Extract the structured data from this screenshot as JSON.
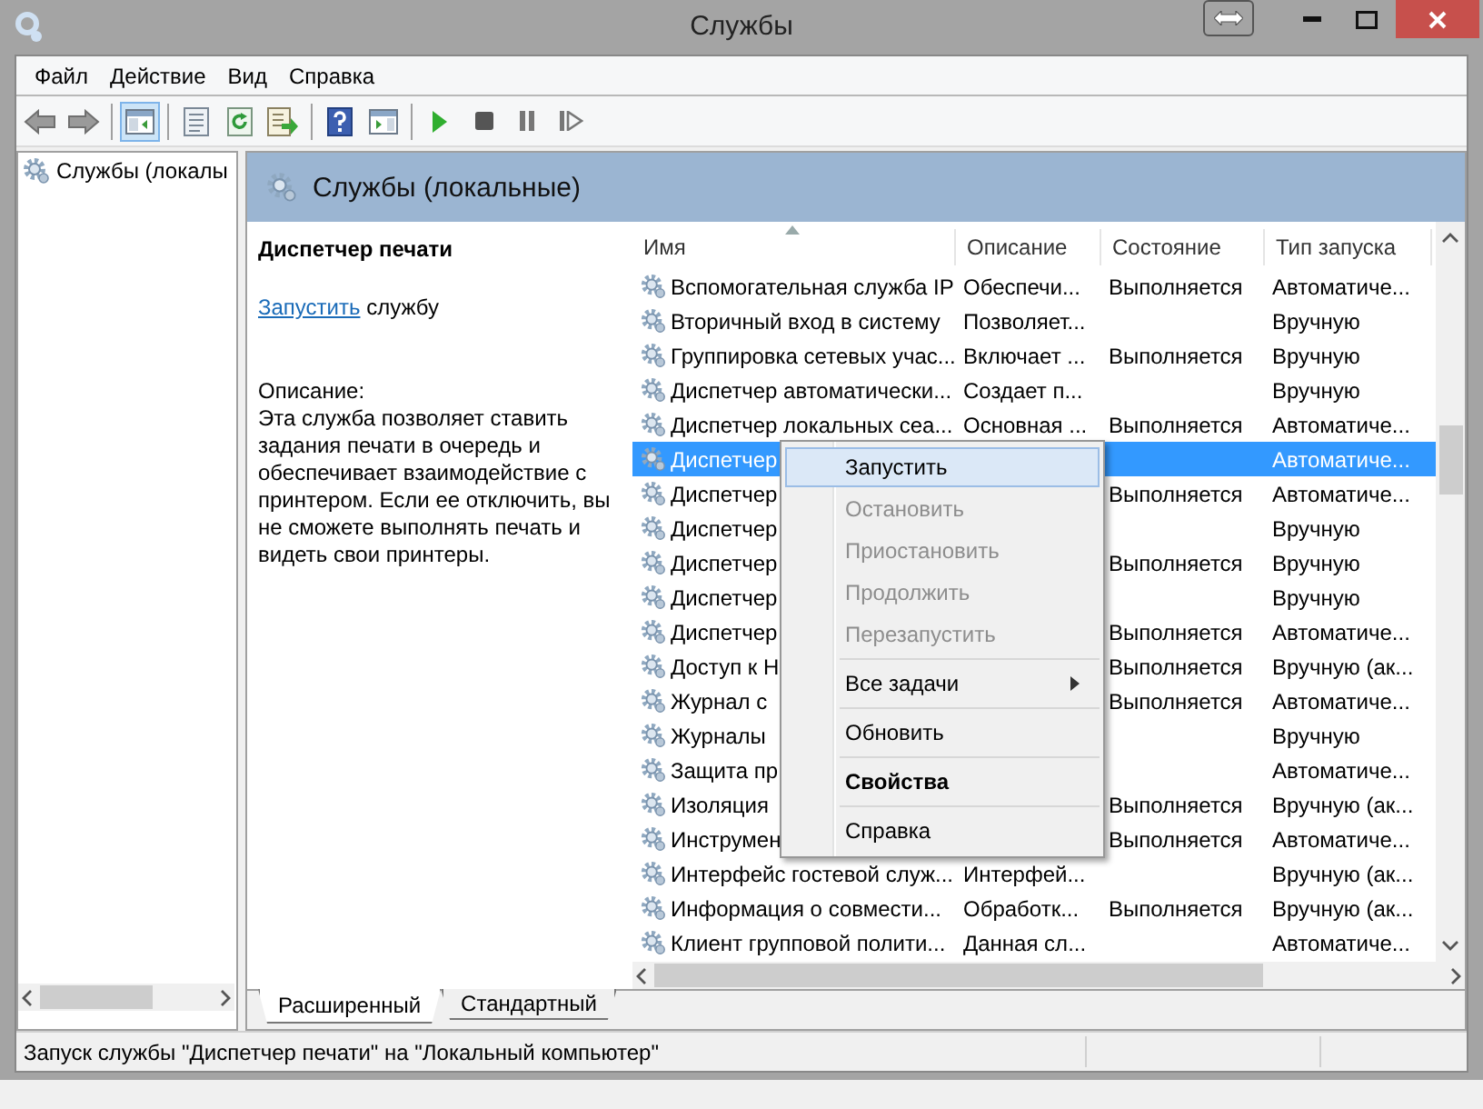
{
  "window": {
    "title": "Службы"
  },
  "menu": [
    "Файл",
    "Действие",
    "Вид",
    "Справка"
  ],
  "toolbar": [
    [
      {
        "kind": "back",
        "pressed": false
      },
      {
        "kind": "forward",
        "pressed": false
      }
    ],
    [
      {
        "kind": "tree",
        "pressed": true
      }
    ],
    [
      {
        "kind": "properties",
        "pressed": false
      },
      {
        "kind": "refresh",
        "pressed": false
      },
      {
        "kind": "export",
        "pressed": false
      }
    ],
    [
      {
        "kind": "help",
        "pressed": false
      },
      {
        "kind": "pane",
        "pressed": false
      }
    ],
    [
      {
        "kind": "play",
        "pressed": false
      },
      {
        "kind": "stop",
        "pressed": false
      },
      {
        "kind": "pause",
        "pressed": false
      },
      {
        "kind": "resume",
        "pressed": false
      }
    ]
  ],
  "tree": {
    "items": [
      {
        "label": "Службы (локалы",
        "selected": false
      }
    ]
  },
  "header": {
    "title": "Службы (локальные)"
  },
  "details": {
    "title": "Диспетчер печати",
    "action_link": "Запустить",
    "action_rest": " службу",
    "description_label": "Описание:",
    "description": "Эта служба позволяет ставить задания печати в очередь и обеспечивает взаимодействие с принтером. Если ее отключить, вы не сможете выполнять печать и видеть свои принтеры."
  },
  "table": {
    "columns": [
      "Имя",
      "Описание",
      "Состояние",
      "Тип запуска"
    ],
    "rows": [
      {
        "name": "Вспомогательная служба IP",
        "description": "Обеспечи...",
        "status": "Выполняется",
        "startup": "Автоматиче...",
        "selected": false
      },
      {
        "name": "Вторичный вход в систему",
        "description": "Позволяет...",
        "startup": "Вручную",
        "selected": false
      },
      {
        "name": "Группировка сетевых учас...",
        "description": "Включает ...",
        "status": "Выполняется",
        "startup": "Вручную",
        "selected": false
      },
      {
        "name": "Диспетчер автоматически...",
        "description": "Создает п...",
        "startup": "Вручную",
        "selected": false
      },
      {
        "name": "Диспетчер локальных сеа...",
        "description": "Основная ...",
        "status": "Выполняется",
        "startup": "Автоматиче...",
        "selected": false
      },
      {
        "name": "Диспетчер",
        "startup": "Автоматиче...",
        "selected": true
      },
      {
        "name": "Диспетчер",
        "status": "Выполняется",
        "startup": "Автоматиче...",
        "selected": false
      },
      {
        "name": "Диспетчер",
        "startup": "Вручную",
        "selected": false
      },
      {
        "name": "Диспетчер",
        "status": "Выполняется",
        "startup": "Вручную",
        "selected": false
      },
      {
        "name": "Диспетчер",
        "startup": "Вручную",
        "selected": false
      },
      {
        "name": "Диспетчер",
        "status": "Выполняется",
        "startup": "Автоматиче...",
        "selected": false
      },
      {
        "name": "Доступ к Н",
        "status": "Выполняется",
        "startup": "Вручную (ак...",
        "selected": false
      },
      {
        "name": "Журнал с",
        "status": "Выполняется",
        "startup": "Автоматиче...",
        "selected": false
      },
      {
        "name": "Журналы",
        "startup": "Вручную",
        "selected": false
      },
      {
        "name": "Защита пр",
        "startup": "Автоматиче...",
        "selected": false
      },
      {
        "name": "Изоляция",
        "status": "Выполняется",
        "startup": "Вручную (ак...",
        "selected": false
      },
      {
        "name": "Инструмен",
        "status": "Выполняется",
        "startup": "Автоматиче...",
        "selected": false
      },
      {
        "name": "Интерфейс гостевой служ...",
        "description": "Интерфей...",
        "startup": "Вручную (ак...",
        "selected": false
      },
      {
        "name": "Информация о совмести...",
        "description": "Обработк...",
        "status": "Выполняется",
        "startup": "Вручную (ак...",
        "selected": false
      },
      {
        "name": "Клиент групповой полити...",
        "description": "Данная сл...",
        "startup": "Автоматиче...",
        "selected": false
      }
    ]
  },
  "context_menu": [
    [
      {
        "label": "Запустить",
        "selected": true,
        "disabled": false
      },
      {
        "label": "Остановить",
        "selected": false,
        "disabled": true
      },
      {
        "label": "Приостановить",
        "selected": false,
        "disabled": true
      },
      {
        "label": "Продолжить",
        "selected": false,
        "disabled": true
      },
      {
        "label": "Перезапустить",
        "selected": false,
        "disabled": true
      }
    ],
    [
      {
        "label": "Все задачи",
        "selected": false,
        "disabled": false,
        "submenu": true
      }
    ],
    [
      {
        "label": "Обновить",
        "selected": false,
        "disabled": false
      }
    ],
    [
      {
        "label": "Свойства",
        "selected": false,
        "disabled": false,
        "default": true
      }
    ],
    [
      {
        "label": "Справка",
        "selected": false,
        "disabled": false
      }
    ]
  ],
  "view_tabs": [
    {
      "label": "Расширенный",
      "selected": true
    },
    {
      "label": "Стандартный",
      "selected": false
    }
  ],
  "status_bar": "Запуск службы \"Диспетчер печати\" на \"Локальный компьютер\""
}
